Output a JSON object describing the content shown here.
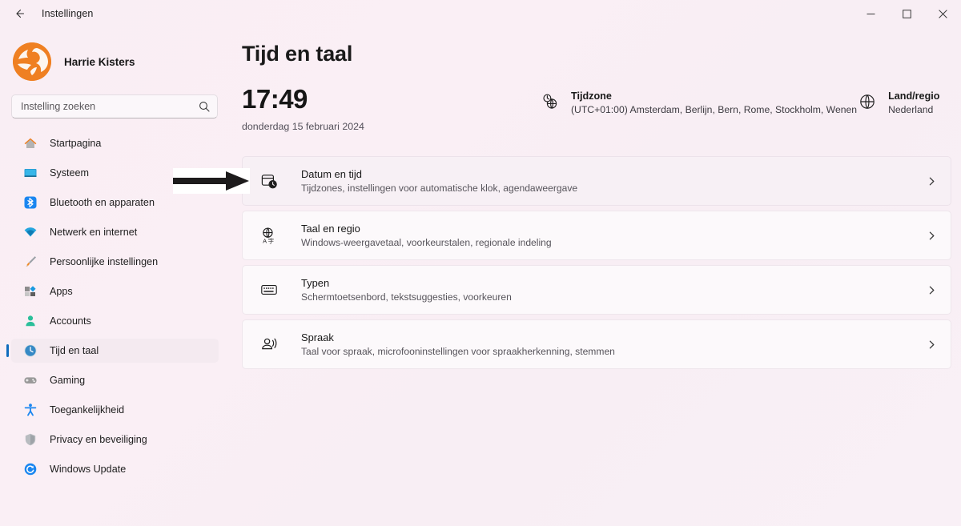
{
  "window": {
    "title": "Instellingen",
    "back_icon": "back-arrow-icon",
    "minimize_label": "—",
    "maximize_label": "□",
    "close_label": "×"
  },
  "sidebar": {
    "profile_name": "Harrie Kisters",
    "search": {
      "placeholder": "Instelling zoeken",
      "value": "",
      "icon": "search-icon"
    },
    "items": [
      {
        "label": "Startpagina",
        "icon": "home-icon",
        "selected": false
      },
      {
        "label": "Systeem",
        "icon": "monitor-icon",
        "selected": false
      },
      {
        "label": "Bluetooth en apparaten",
        "icon": "bluetooth-icon",
        "selected": false
      },
      {
        "label": "Netwerk en internet",
        "icon": "wifi-icon",
        "selected": false
      },
      {
        "label": "Persoonlijke instellingen",
        "icon": "paintbrush-icon",
        "selected": false
      },
      {
        "label": "Apps",
        "icon": "apps-icon",
        "selected": false
      },
      {
        "label": "Accounts",
        "icon": "account-icon",
        "selected": false
      },
      {
        "label": "Tijd en taal",
        "icon": "clock-globe-icon",
        "selected": true
      },
      {
        "label": "Gaming",
        "icon": "gamepad-icon",
        "selected": false
      },
      {
        "label": "Toegankelijkheid",
        "icon": "accessibility-icon",
        "selected": false
      },
      {
        "label": "Privacy en beveiliging",
        "icon": "shield-icon",
        "selected": false
      },
      {
        "label": "Windows Update",
        "icon": "update-icon",
        "selected": false
      }
    ]
  },
  "main": {
    "page_title": "Tijd en taal",
    "clock": {
      "time": "17:49",
      "date": "donderdag 15 februari 2024"
    },
    "timezone": {
      "icon": "clock-globe-icon",
      "label": "Tijdzone",
      "value": "(UTC+01:00) Amsterdam, Berlijn, Bern, Rome, Stockholm, Wenen"
    },
    "region": {
      "icon": "globe-icon",
      "label": "Land/regio",
      "value": "Nederland"
    },
    "cards": [
      {
        "icon": "calendar-clock-icon",
        "title": "Datum en tijd",
        "subtitle": "Tijdzones, instellingen voor automatische klok, agendaweergave",
        "chevron": "chevron-right-icon",
        "highlighted": true
      },
      {
        "icon": "language-globe-icon",
        "title": "Taal en regio",
        "subtitle": "Windows-weergavetaal, voorkeurstalen, regionale indeling",
        "chevron": "chevron-right-icon",
        "highlighted": false
      },
      {
        "icon": "keyboard-icon",
        "title": "Typen",
        "subtitle": "Schermtoetsenbord, tekstsuggesties, voorkeuren",
        "chevron": "chevron-right-icon",
        "highlighted": false
      },
      {
        "icon": "speech-icon",
        "title": "Spraak",
        "subtitle": "Taal voor spraak, microfooninstellingen voor spraakherkenning, stemmen",
        "chevron": "chevron-right-icon",
        "highlighted": false
      }
    ]
  },
  "annotation": {
    "arrow_icon": "right-arrow-annotation",
    "points_at": "Datum en tijd"
  },
  "colors": {
    "accent": "#0f6cbd",
    "background_start": "#f9eef4",
    "background_end": "#f9f0f6",
    "card": "#fcf9fb",
    "logo_orange": "#ef8022"
  }
}
